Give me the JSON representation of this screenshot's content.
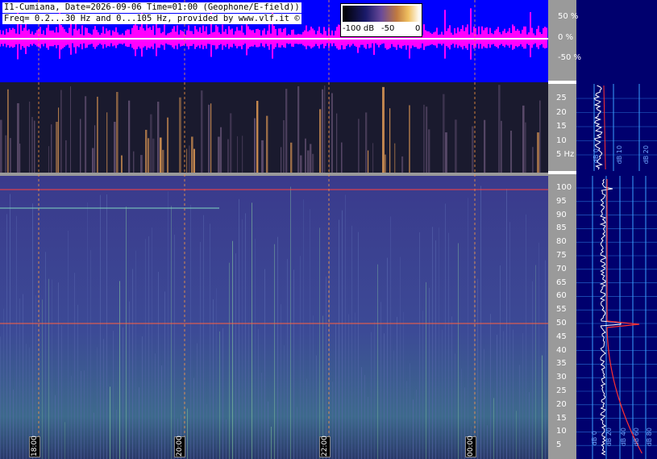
{
  "header": {
    "line1": "I1-Cumiana, Date=2026-09-06 Time=01:00 (Geophone/E-field))",
    "line2": "Freq= 0.2...30 Hz and 0...105 Hz, provided by www.vlf.it ©"
  },
  "legend": {
    "labels": [
      "-100 dB",
      "-50",
      "0"
    ]
  },
  "chart_data": [
    {
      "type": "line",
      "name": "waveform",
      "y_ticks": [
        "50 %",
        "0 %",
        "-50 %"
      ]
    },
    {
      "type": "heatmap",
      "name": "spectrogram-low",
      "y_range": [
        0,
        30
      ],
      "y_ticks": [
        "25",
        "20",
        "15",
        "10",
        "5 Hz"
      ]
    },
    {
      "type": "heatmap",
      "name": "spectrogram-high",
      "y_range": [
        0,
        105
      ],
      "y_ticks": [
        "100",
        "95",
        "90",
        "85",
        "80",
        "75",
        "70",
        "65",
        "60",
        "55",
        "50",
        "45",
        "40",
        "35",
        "30",
        "25",
        "20",
        "15",
        "10",
        "5"
      ],
      "time_labels": [
        "18:00",
        "20:00",
        "22:00",
        "00:00"
      ]
    }
  ],
  "side_labels_top": [
    "dB 0",
    "dB 10",
    "dB 20"
  ],
  "side_labels_bottom": [
    "dB 0",
    "dB 20",
    "dB 40",
    "dB 60",
    "dB 80"
  ],
  "colors": {
    "waveform_bg": "#0000ff",
    "waveform": "#ff00ff",
    "axis_gray": "#9a9a9a",
    "side_bg": "#00006e",
    "grid": "#3aa0ff"
  }
}
